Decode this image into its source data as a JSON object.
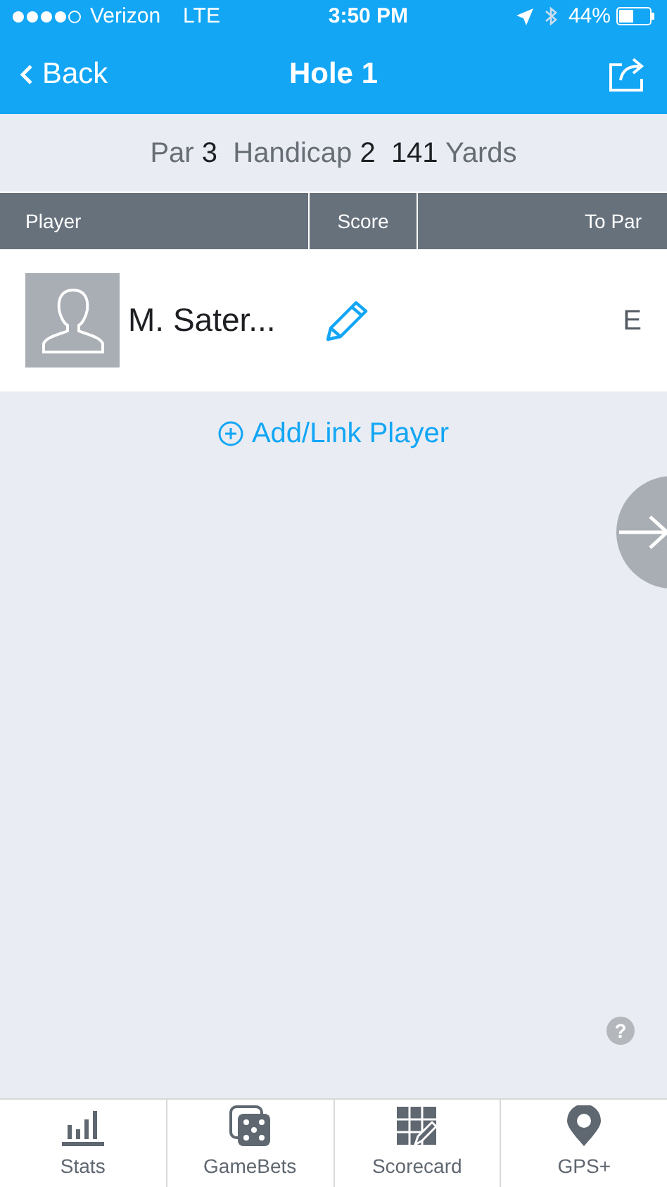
{
  "status_bar": {
    "carrier": "Verizon",
    "network": "LTE",
    "time": "3:50 PM",
    "battery": "44%"
  },
  "nav": {
    "back": "Back",
    "title": "Hole 1"
  },
  "hole_info": "Par **3**  Handicap **2**  **141** Yards",
  "table": {
    "columns": [
      "Player",
      "Score",
      "To Par"
    ],
    "rows": [
      {
        "player": "M. Sater...",
        "to_par": "E"
      }
    ]
  },
  "add_link": "Add/Link Player",
  "help": "?",
  "tab_bar": [
    {
      "label": "Stats",
      "kind": "stats"
    },
    {
      "label": "GameBets",
      "kind": "dice"
    },
    {
      "label": "Scorecard",
      "kind": "scorecard"
    },
    {
      "label": "GPS+",
      "kind": "pin"
    }
  ]
}
